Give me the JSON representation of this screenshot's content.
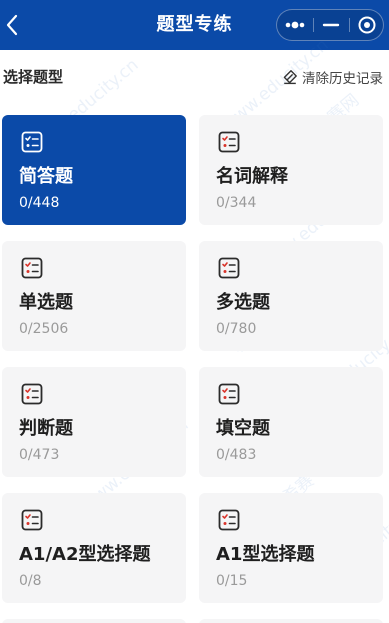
{
  "header": {
    "title": "题型专练",
    "back_icon": "chevron-left-icon",
    "more_icon": "more-dots-icon",
    "minimize_icon": "minimize-icon",
    "close_icon": "target-close-icon",
    "bar_color": "#0b4aa8"
  },
  "section": {
    "title": "选择题型",
    "clear_label": "清除历史记录",
    "clear_icon": "eraser-icon"
  },
  "cards": [
    {
      "name": "简答题",
      "count": "0/448",
      "active": true,
      "icon": "checklist-icon"
    },
    {
      "name": "名词解释",
      "count": "0/344",
      "active": false,
      "icon": "checklist-icon"
    },
    {
      "name": "单选题",
      "count": "0/2506",
      "active": false,
      "icon": "checklist-icon"
    },
    {
      "name": "多选题",
      "count": "0/780",
      "active": false,
      "icon": "checklist-icon"
    },
    {
      "name": "判断题",
      "count": "0/473",
      "active": false,
      "icon": "checklist-icon"
    },
    {
      "name": "填空题",
      "count": "0/483",
      "active": false,
      "icon": "checklist-icon"
    },
    {
      "name": "A1/A2型选择题",
      "count": "0/8",
      "active": false,
      "icon": "checklist-icon"
    },
    {
      "name": "A1型选择题",
      "count": "0/15",
      "active": false,
      "icon": "checklist-icon"
    }
  ],
  "watermarks": [
    "www.educity.cn",
    "希赛网",
    "希赛"
  ],
  "colors": {
    "accent": "#0b4aa8",
    "icon_red": "#d9342b",
    "card_bg": "#f5f5f6"
  }
}
